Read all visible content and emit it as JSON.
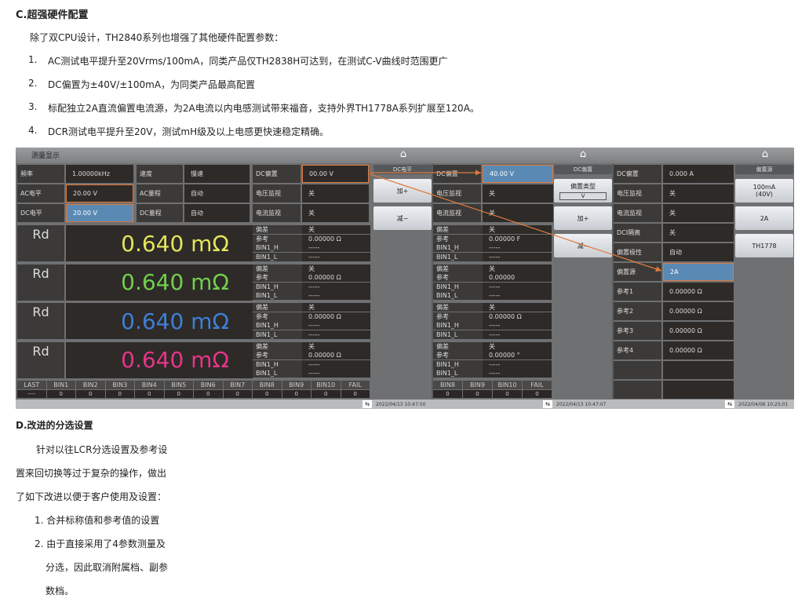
{
  "doc": {
    "section_c_title": "C.超强硬件配置",
    "section_c_intro": "除了双CPU设计，TH2840系列也增强了其他硬件配置参数：",
    "section_c_items": [
      {
        "num": "1.",
        "text": "AC测试电平提升至20Vrms/100mA，同类产品仅TH2838H可达到，在测试C-V曲线时范围更广"
      },
      {
        "num": "2.",
        "text": "DC偏置为±40V/±100mA，为同类产品最高配置"
      },
      {
        "num": "3.",
        "text": "标配独立2A直流偏置电流源，为2A电流以内电感测试带来福音，支持外界TH1778A系列扩展至120A。"
      },
      {
        "num": "4.",
        "text": "DCR测试电平提升至20V，测试mH级及以上电感更快速稳定精确。"
      }
    ],
    "section_d_title": "D.改进的分选设置",
    "section_d_para": [
      "针对以往LCR分选设置及参考设",
      "置来回切换等过于复杂的操作，做出",
      "了如下改进以便于客户使用及设置："
    ],
    "section_d_items": [
      "1. 合并标称值和参考值的设置",
      "2. 由于直接采用了4参数测量及",
      "分选，因此取消附属档、副参",
      "数档。"
    ]
  },
  "screen": {
    "title": "测量显示",
    "p1_params": [
      [
        "频率",
        "1.00000kHz",
        "速度",
        "慢速",
        "DC偏置",
        "00.00 V"
      ],
      [
        "AC电平",
        "20.00 V",
        "AC量程",
        "自动",
        "电压监视",
        "关"
      ],
      [
        "DC电平",
        "20.00 V",
        "DC量程",
        "自动",
        "电流监视",
        "关"
      ]
    ],
    "p1_softkeys": {
      "title": "DC电平",
      "buttons": [
        "加+",
        "减−"
      ]
    },
    "measurements": [
      {
        "param": "Rd",
        "value": "0.640 mΩ",
        "color": "#e4e45c"
      },
      {
        "param": "Rd",
        "value": "0.640 mΩ",
        "color": "#72cf4c"
      },
      {
        "param": "Rd",
        "value": "0.640 mΩ",
        "color": "#3f7fd6"
      },
      {
        "param": "Rd",
        "value": "0.640 mΩ",
        "color": "#e8348a"
      }
    ],
    "info_labels": [
      "偏差",
      "参考",
      "BIN1_H",
      "BIN1_L"
    ],
    "p1_info": [
      [
        "关",
        "0.00000 Ω",
        "-----",
        "-----"
      ],
      [
        "关",
        "0.00000 Ω",
        "-----",
        "-----"
      ],
      [
        "关",
        "0.00000 Ω",
        "-----",
        "-----"
      ],
      [
        "关",
        "0.00000 Ω",
        "-----",
        "-----"
      ]
    ],
    "p2_info": [
      [
        "关",
        "0.00000 F",
        "-----",
        "-----"
      ],
      [
        "关",
        "0.00000",
        "-----",
        "-----"
      ],
      [
        "关",
        "0.00000 Ω",
        "-----",
        "-----"
      ],
      [
        "关",
        "0.00000 °",
        "-----",
        "-----"
      ]
    ],
    "bins_p1": {
      "headers": [
        "LAST",
        "BIN1",
        "BIN2",
        "BIN3",
        "BIN4",
        "BIN5",
        "BIN6",
        "BIN7",
        "BIN8",
        "BIN9",
        "BIN10",
        "FAIL"
      ],
      "values": [
        "----",
        "0",
        "0",
        "0",
        "0",
        "0",
        "0",
        "0",
        "0",
        "0",
        "0",
        "0"
      ]
    },
    "bins_p2": {
      "headers": [
        "BIN8",
        "BIN9",
        "BIN10",
        "FAIL"
      ],
      "values": [
        "0",
        "0",
        "0",
        "0"
      ]
    },
    "p2_params": [
      [
        "DC偏置",
        "40.00 V"
      ],
      [
        "电压监视",
        "关"
      ],
      [
        "电流监视",
        "关"
      ]
    ],
    "p2_softkeys": {
      "title": "DC偏置",
      "type_label": "偏置类型",
      "type_value": "V",
      "buttons": [
        "加+",
        "减−"
      ]
    },
    "p3_params": [
      [
        "DC偏置",
        "0.000 A"
      ],
      [
        "电压监视",
        "关"
      ],
      [
        "电流监视",
        "关"
      ],
      [
        "DCI隔离",
        "关"
      ],
      [
        "偏置极性",
        "自动"
      ],
      [
        "偏置源",
        "2A"
      ],
      [
        "参考1",
        "0.00000 Ω"
      ],
      [
        "参考2",
        "0.00000 Ω"
      ],
      [
        "参考3",
        "0.00000 Ω"
      ],
      [
        "参考4",
        "0.00000 Ω"
      ],
      [
        "",
        ""
      ],
      [
        "",
        ""
      ]
    ],
    "p3_softkeys": {
      "title": "偏置源",
      "buttons": [
        "100mA\n(40V)",
        "2A",
        "TH1778"
      ]
    },
    "timestamps": [
      "2022/04/13 10:47:50",
      "2022/04/13 10:47:07",
      "2022/04/06 10:25:01"
    ],
    "colors": {
      "accent": "#e07a3c",
      "selected": "#5a8ab4"
    }
  }
}
